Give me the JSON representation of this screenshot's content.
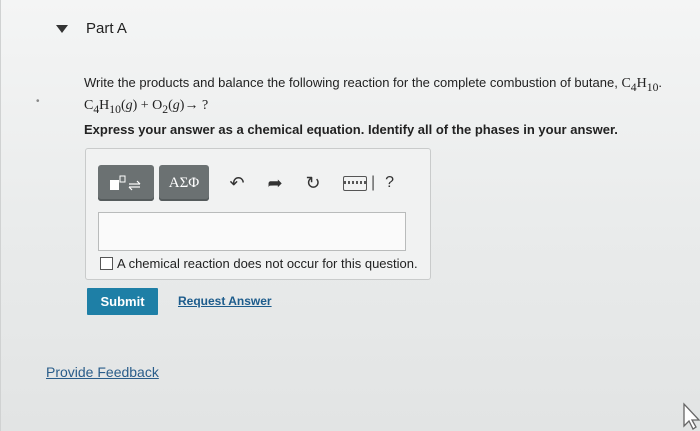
{
  "part": {
    "title": "Part A"
  },
  "question": {
    "text": "Write the products and balance the following reaction for the complete combustion of butane,",
    "formula_butane": "C4H10",
    "reaction": "C4H10(g) + O2(g) → ?"
  },
  "instruction": "Express your answer as a chemical equation. Identify all of the phases in your answer.",
  "toolbar": {
    "templates_icon": "templates-icon",
    "symbols_label": "ΑΣΦ",
    "undo_icon": "undo-icon",
    "redo_icon": "redo-icon",
    "reset_icon": "reset-icon",
    "keyboard_icon": "keyboard-icon",
    "help_label": "?"
  },
  "answer": {
    "value": ""
  },
  "no_reaction": {
    "label": "A chemical reaction does not occur for this question.",
    "checked": false
  },
  "actions": {
    "submit_label": "Submit",
    "request_answer_label": "Request Answer"
  },
  "feedback": {
    "label": "Provide Feedback"
  },
  "colors": {
    "submit_bg": "#1e7fa6",
    "toolbar_btn": "#6b7172",
    "link": "#1d5c8c"
  }
}
